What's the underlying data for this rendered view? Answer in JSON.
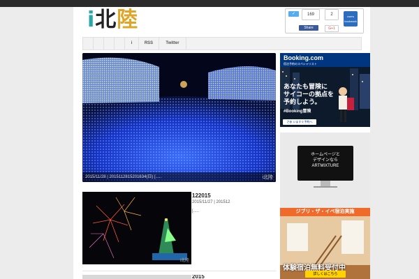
{
  "site": {
    "logo_text": "i北陸"
  },
  "share": {
    "twitter_label": "",
    "twitter_count": "169",
    "facebook_count": "2",
    "facebook_label": "Share",
    "gplus_label": "G+1",
    "hatena_users": "users",
    "hatena_label": "bookmark"
  },
  "nav": {
    "items": [
      {
        "label": ""
      },
      {
        "label": ""
      },
      {
        "label": ""
      },
      {
        "label": ""
      },
      {
        "label": "i"
      },
      {
        "label": "RSS"
      },
      {
        "label": "Twitter"
      }
    ]
  },
  "featured": {
    "caption": "2015/11/28 | 2015112815201634(日) [.....",
    "watermark": "i北陸"
  },
  "posts": [
    {
      "title": "122015",
      "meta": "2015/11/27 | 201512",
      "excerpt": "[.....",
      "thumb_watermark": "i北陸"
    },
    {
      "title": "2015",
      "meta": "",
      "excerpt": ""
    }
  ],
  "ads": {
    "booking": {
      "logo": "Booking.com",
      "sub": "宿泊予約のスペシャリスト",
      "copy_line1": "あなたも冒険に",
      "copy_line2": "サイコーの拠点を",
      "copy_line3": "予約しよう。",
      "tag": "#Booking冒険",
      "cta": "さあ いますぐ予約へ"
    },
    "artmixture": {
      "monitor_line1": "ホームページと",
      "monitor_line2": "デザインなら",
      "monitor_line3": "ARTMIXTURE",
      "banner": "ジブリ・ザ・イベ宿泊実施",
      "big": "体験宿泊無料受付中",
      "cta": "詳しくはこちら"
    }
  }
}
